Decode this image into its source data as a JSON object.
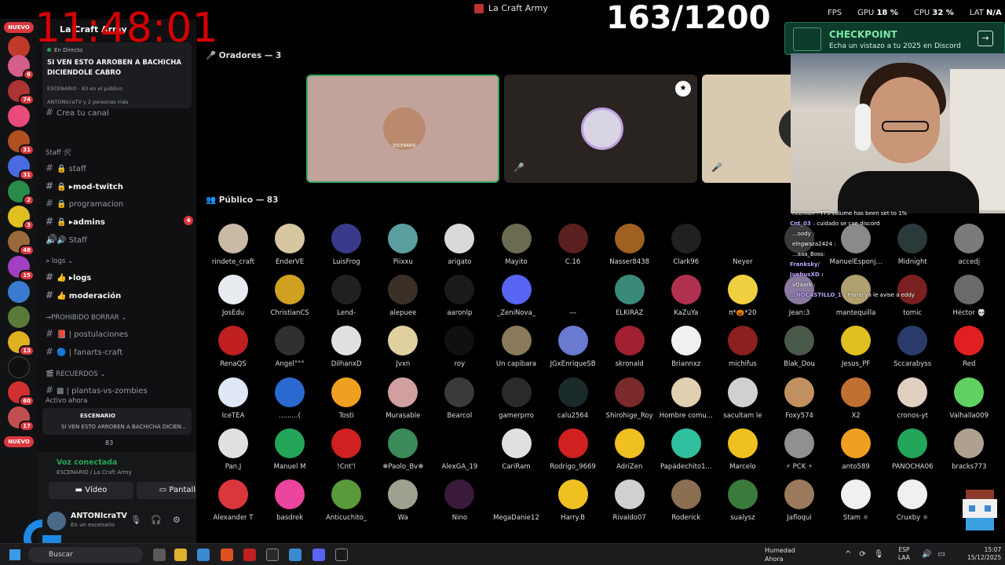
{
  "window": {
    "title": "La Craft Army"
  },
  "perf": {
    "fps_label": "FPS",
    "fps": "",
    "gpu_label": "GPU",
    "gpu": "18 %",
    "cpu_label": "CPU",
    "cpu": "32 %",
    "lat_label": "LAT",
    "lat": "N/A"
  },
  "timer": "11:48:01",
  "counter": "163/1200",
  "server": {
    "name": "La Craft Army"
  },
  "live_card": {
    "status": "En Directo",
    "headline": "SI VEN ESTO ARROBEN A BACHICHA DICIENDOLE CABRO",
    "stage_label": "ESCENARIO",
    "public_count": "83 en el público",
    "people": "ANTONIcraTV y 2 personas más",
    "create_channel": "Crea tu canal"
  },
  "rail": {
    "nuevo_top": "NUEVO",
    "nuevo_bottom": "NUEVO",
    "badges": [
      "6",
      "74",
      "31",
      "31",
      "2",
      "3",
      "48",
      "15",
      "13",
      "60",
      "17"
    ]
  },
  "channels": [
    {
      "type": "cat",
      "label": "Staff 🛠"
    },
    {
      "type": "chan",
      "label": "🔒 staff",
      "bold": false
    },
    {
      "type": "chan",
      "label": "🔒 ▸mod-twitch",
      "bold": true
    },
    {
      "type": "chan",
      "label": "🔒 programacion",
      "bold": false
    },
    {
      "type": "chan",
      "label": "🔒 ▸admins",
      "bold": true,
      "badge": "4"
    },
    {
      "type": "voice",
      "label": "🔊 Staff",
      "bold": false
    },
    {
      "type": "cat",
      "label": "» logs ⌄"
    },
    {
      "type": "chan",
      "label": "👍 ▸logs",
      "bold": true
    },
    {
      "type": "chan",
      "label": "👍 moderación",
      "bold": true
    },
    {
      "type": "cat",
      "label": "→PROHIBIDO BORRAR ⌄"
    },
    {
      "type": "chan",
      "label": "📕 | postulaciones",
      "bold": false
    },
    {
      "type": "chan",
      "label": "🔵 | fanarts-craft",
      "bold": false
    },
    {
      "type": "cat",
      "label": "🎬 RECUERDOS ⌄"
    },
    {
      "type": "chan",
      "label": "▩ | plantas-vs-zombies",
      "bold": false
    },
    {
      "type": "cat",
      "label": "Activo ahora"
    }
  ],
  "active_card": {
    "title": "ESCENARIO",
    "sub": "SI VEN ESTO ARROBEN A BACHICHA DICIEN...",
    "count": "83"
  },
  "voice": {
    "connected": "Voz conectada",
    "location": "ESCENARIO / La Craft Army",
    "video_label": "Vídeo",
    "screen_label": "Pantalla"
  },
  "user": {
    "name": "ANTONIcraTV",
    "status": "En un escenario"
  },
  "stage": {
    "speakers_heading": "Oradores — 3",
    "public_heading": "Público — 83"
  },
  "speakers": [
    {
      "bg": "#c2a39b",
      "border": "#3ba55d",
      "avatar": "#b98a6e",
      "label": "ESCENARIO"
    },
    {
      "bg": "#2a2420",
      "border": "#2a2420",
      "avatar": "#d9d4e3",
      "label": ""
    },
    {
      "bg": "#d9c9b0",
      "border": "#d9c9b0",
      "avatar": "#2a2a2a",
      "label": ""
    }
  ],
  "audience": [
    [
      {
        "n": "rindete_craft",
        "c": "#c9b9a5"
      },
      {
        "n": "EnderVE",
        "c": "#d7c7a0"
      },
      {
        "n": "LuisFrog",
        "c": "#3a3a8a"
      },
      {
        "n": "Piixxu",
        "c": "#5a9ea0"
      },
      {
        "n": "arigato",
        "c": "#d9d9d9"
      },
      {
        "n": "Mayito",
        "c": "#6b6b50"
      },
      {
        "n": "C.16",
        "c": "#5a2020"
      },
      {
        "n": "Nasser8438",
        "c": "#a06020"
      },
      {
        "n": "Clark96",
        "c": "#202020"
      },
      {
        "n": "Neyer",
        "c": "#000000"
      },
      {
        "n": "",
        "c": "#3a3a3a"
      },
      {
        "n": "ManuelEsponj...",
        "c": "#8a8a8a"
      },
      {
        "n": "Midnight",
        "c": "#2a3a3a"
      },
      {
        "n": "accedj",
        "c": "#7a7a7a"
      }
    ],
    [
      {
        "n": "JosEdu",
        "c": "#e8ecf0"
      },
      {
        "n": "ChristianCS",
        "c": "#d0a020"
      },
      {
        "n": "Lend-",
        "c": "#202020"
      },
      {
        "n": "alepuee",
        "c": "#3a3028"
      },
      {
        "n": "aaronlp",
        "c": "#1a1a1a"
      },
      {
        "n": "_ZeniNova_",
        "c": "#5865f2"
      },
      {
        "n": "---",
        "c": ""
      },
      {
        "n": "ELKIRAZ",
        "c": "#3a8a7a"
      },
      {
        "n": "KaZuYa",
        "c": "#b03050"
      },
      {
        "n": "π*🎃*20",
        "c": "#f0d040"
      },
      {
        "n": "Jean:3",
        "c": "#8a7aa0"
      },
      {
        "n": "mantequilla",
        "c": "#b0a070"
      },
      {
        "n": "tomic",
        "c": "#7a2020"
      },
      {
        "n": "Héctor 💀",
        "c": "#6a6a6a"
      }
    ],
    [
      {
        "n": "RenaQS",
        "c": "#c02020"
      },
      {
        "n": "Angel°°°",
        "c": "#303030"
      },
      {
        "n": "DilhanxD",
        "c": "#e0e0e0"
      },
      {
        "n": "Jvxn",
        "c": "#e0d0a0"
      },
      {
        "n": "roy",
        "c": "#101010"
      },
      {
        "n": "Un capibara",
        "c": "#8a7a5a"
      },
      {
        "n": "JGxEnriqueSB",
        "c": "#6a7ad0"
      },
      {
        "n": "skronald",
        "c": "#a02030"
      },
      {
        "n": "Briannxz",
        "c": "#f0f0f0"
      },
      {
        "n": "michifus",
        "c": "#8a2020"
      },
      {
        "n": "Blak_Dou",
        "c": "#4a5a4a"
      },
      {
        "n": "Jesus_PF",
        "c": "#e0c020"
      },
      {
        "n": "Sccarabyss",
        "c": "#2a3a6a"
      },
      {
        "n": "Red",
        "c": "#e02020"
      }
    ],
    [
      {
        "n": "IceTEA",
        "c": "#e0e8f8"
      },
      {
        "n": ".........(",
        "c": "#2a6ad0"
      },
      {
        "n": "Tosti",
        "c": "#f0a020"
      },
      {
        "n": "Murasable",
        "c": "#d0a0a0"
      },
      {
        "n": "Bearcol",
        "c": "#3a3a3a"
      },
      {
        "n": "gamerprro",
        "c": "#2a2a2a"
      },
      {
        "n": "calu2564",
        "c": "#1a2a2a"
      },
      {
        "n": "Shirohige_Roy",
        "c": "#7a2a2a"
      },
      {
        "n": "Hombre comu...",
        "c": "#e0d0b0"
      },
      {
        "n": "sacultam le",
        "c": "#d0d0d0"
      },
      {
        "n": "Foxy574",
        "c": "#c09060"
      },
      {
        "n": "X2",
        "c": "#c07030"
      },
      {
        "n": "cronos-yt",
        "c": "#e0d0c0"
      },
      {
        "n": "Valhalla009",
        "c": "#60d060"
      }
    ],
    [
      {
        "n": "Pan.J",
        "c": "#e0e0e0"
      },
      {
        "n": "Manuel M",
        "c": "#23a55a"
      },
      {
        "n": "!Cnt'!",
        "c": "#d02020"
      },
      {
        "n": "❄Paolo_Bv❄",
        "c": "#3a8a5a"
      },
      {
        "n": "AlexGA_19",
        "c": "#000000"
      },
      {
        "n": "CariRam",
        "c": "#e0e0e0"
      },
      {
        "n": "Rodrigo_9669",
        "c": "#d02020"
      },
      {
        "n": "AdriZen",
        "c": "#f0c020"
      },
      {
        "n": "Papádechito1...",
        "c": "#30c0a0"
      },
      {
        "n": "Marcelo",
        "c": "#f0c020"
      },
      {
        "n": "⚡ PCK ⚡",
        "c": "#909090"
      },
      {
        "n": "anto589",
        "c": "#f0a020"
      },
      {
        "n": "PANOCHA06",
        "c": "#23a55a"
      },
      {
        "n": "bracks773",
        "c": "#b0a090"
      }
    ],
    [
      {
        "n": "Alexander T",
        "c": "#da373c"
      },
      {
        "n": "basdrek",
        "c": "#eb459e"
      },
      {
        "n": "Anticuchito_",
        "c": "#5a9a3a"
      },
      {
        "n": "Wa",
        "c": "#a0a090"
      },
      {
        "n": "Nino",
        "c": "#3a1a3a"
      },
      {
        "n": "MegaDanie12",
        "c": ""
      },
      {
        "n": "Harry.B",
        "c": "#f0c020"
      },
      {
        "n": "Rivaldo07",
        "c": "#d0d0d0"
      },
      {
        "n": "Roderick",
        "c": "#8a7050"
      },
      {
        "n": "sualysz",
        "c": "#3a7a3a"
      },
      {
        "n": "Jafloqui",
        "c": "#9a7a5a"
      },
      {
        "n": "Stam ⚛",
        "c": "#f0f0f0"
      },
      {
        "n": "Cruxby ⚛",
        "c": "#f0f0f0"
      },
      {
        "n": "",
        "c": ""
      }
    ]
  ],
  "checkpoint": {
    "title": "CHECKPOINT",
    "subtitle": "Echa un vistazo a tu 2025 en Discord"
  },
  "chat": [
    {
      "u": "",
      "t": "ricemon : TTS volume has been set to 1%"
    },
    {
      "u": "Cnt_03",
      "t": ": cuidado se cae discord"
    },
    {
      "u": "",
      "t": "...oody :"
    },
    {
      "u": "",
      "t": "elngwaza2424 :"
    },
    {
      "u": "",
      "t": "...aaa_Boss:"
    },
    {
      "u": "Franksky/",
      "t": ""
    },
    {
      "u": "JuebusXD :",
      "t": ""
    },
    {
      "u": "",
      "t": "vDaark :"
    },
    {
      "u": "...NOCASTILLO_1",
      "t": ": mano ya le avise a eddy"
    }
  ],
  "taskbar": {
    "search": "Buscar",
    "weather_title": "Humedad",
    "weather_sub": "Ahora",
    "lang1": "ESP",
    "lang2": "LAA",
    "time": "15:07",
    "date": "15/12/2025"
  },
  "colors": {
    "accent_green": "#23a55a",
    "discord_blurple": "#5865f2",
    "danger": "#da373c",
    "timer_red": "#e00000"
  }
}
